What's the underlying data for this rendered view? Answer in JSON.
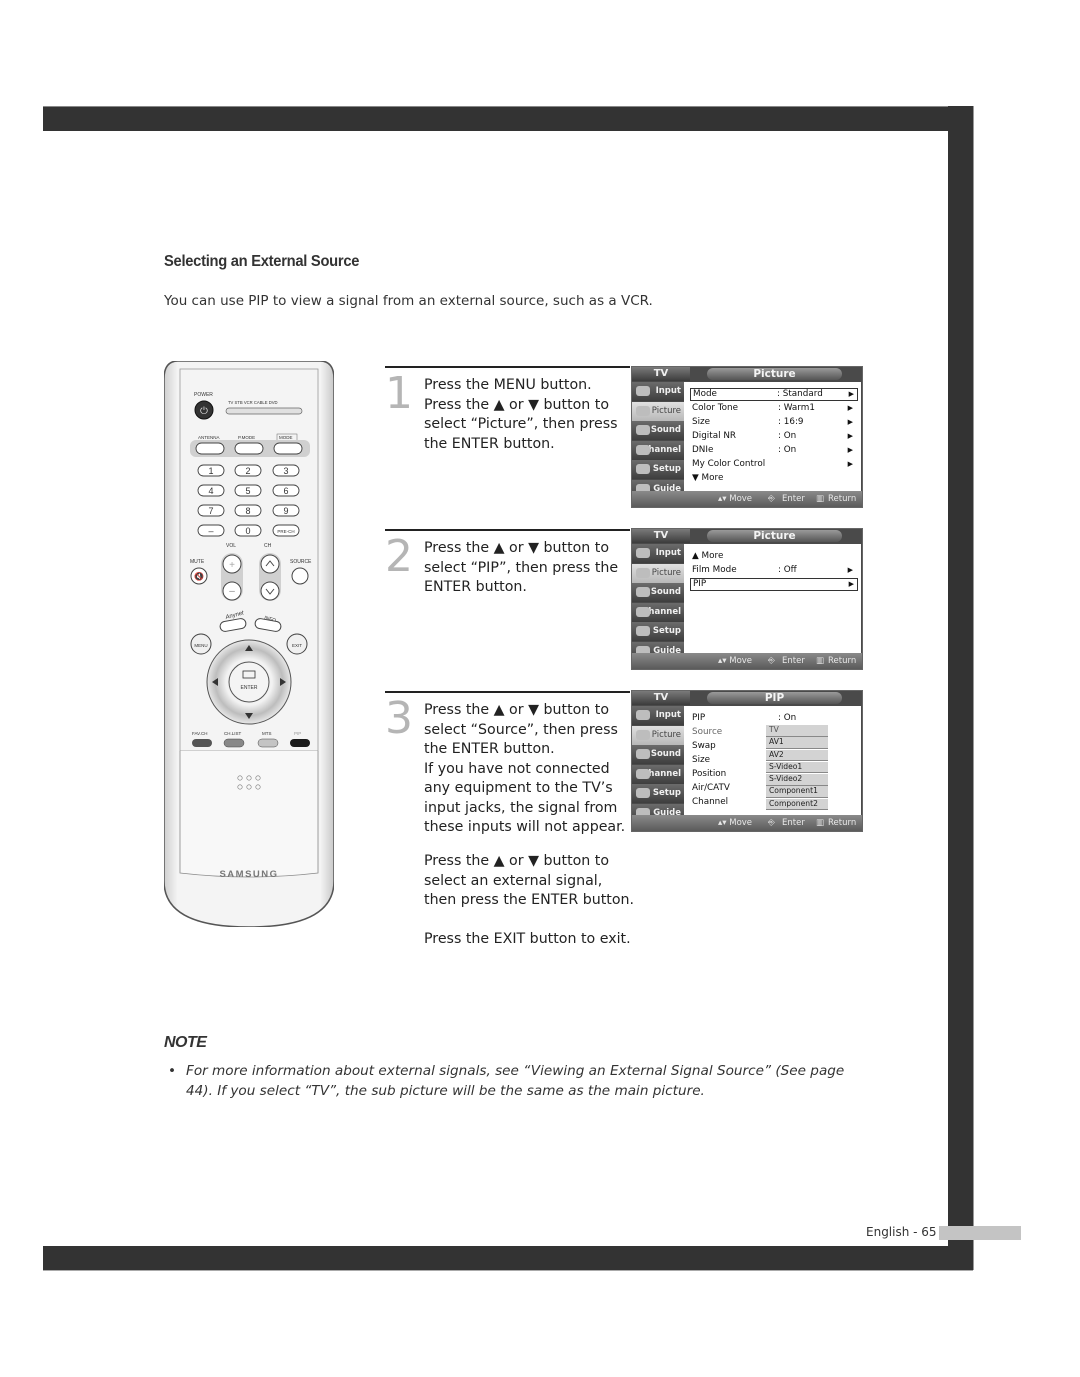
{
  "section": {
    "title": "Selecting an External Source",
    "intro": "You can use PIP to view a signal from an external source, such as a VCR."
  },
  "remote": {
    "brand": "SAMSUNG",
    "labels": {
      "power": "POWER",
      "modes": [
        "TV",
        "STB",
        "VCR",
        "CABLE",
        "DVD"
      ],
      "antenna": "ANTENNA",
      "pmode": "P.MODE",
      "mode": "MODE",
      "digits": [
        "1",
        "2",
        "3",
        "4",
        "5",
        "6",
        "7",
        "8",
        "9",
        "—",
        "0",
        "PRE-CH"
      ],
      "vol": "VOL",
      "ch": "CH",
      "mute": "MUTE",
      "source": "SOURCE",
      "info": "INFO",
      "menu": "MENU",
      "exit": "EXIT",
      "enter": "ENTER",
      "favch": "FAV.CH",
      "chlist": "CH.LIST",
      "mts": "MTS",
      "pip": "PIP"
    }
  },
  "steps": [
    {
      "number": "1",
      "lines": [
        "Press the MENU button.",
        "Press the ▲ or ▼ button to",
        "select “Picture”, then press",
        "the ENTER button."
      ]
    },
    {
      "number": "2",
      "lines": [
        "Press the ▲ or ▼ button to",
        "select “PIP”, then press the",
        "ENTER button."
      ]
    },
    {
      "number": "3",
      "lines": [
        "Press the ▲ or ▼ button to",
        "select “Source”, then press",
        "the ENTER button.",
        "If you have not connected",
        "any equipment to the TV’s",
        "input jacks, the signal from",
        "these inputs will not appear."
      ],
      "extra1": [
        "Press the ▲ or ▼ button to",
        "select an external signal,",
        "then press the ENTER button."
      ],
      "extra2": "Press the EXIT button to exit."
    }
  ],
  "osd_common": {
    "tv_label": "TV",
    "sidebar": [
      "Input",
      "Picture",
      "Sound",
      "Channel",
      "Setup",
      "Guide"
    ],
    "footer": {
      "move": "▴▾ Move",
      "enter": "Enter",
      "return": "Return"
    }
  },
  "osd": [
    {
      "title": "Picture",
      "rows": [
        {
          "label": "Mode",
          "value": ": Standard",
          "arrow": "▶",
          "selected": true
        },
        {
          "label": "Color Tone",
          "value": ": Warm1",
          "arrow": "▶"
        },
        {
          "label": "Size",
          "value": ": 16:9",
          "arrow": "▶"
        },
        {
          "label": "Digital NR",
          "value": ": On",
          "arrow": "▶"
        },
        {
          "label": "DNIe",
          "value": ": On",
          "arrow": "▶"
        },
        {
          "label": "My Color Control",
          "value": "",
          "arrow": "▶"
        },
        {
          "label": "▼ More",
          "value": "",
          "arrow": ""
        }
      ]
    },
    {
      "title": "Picture",
      "rows": [
        {
          "label": "▲ More",
          "value": "",
          "arrow": ""
        },
        {
          "label": "Film Mode",
          "value": ": Off",
          "arrow": "▶"
        },
        {
          "label": "PIP",
          "value": "",
          "arrow": "▶",
          "selected": true
        }
      ]
    },
    {
      "title": "PIP",
      "rows": [
        {
          "label": "PIP",
          "value": ": On"
        },
        {
          "label": "Source",
          "value": ""
        },
        {
          "label": "Swap",
          "value": ""
        },
        {
          "label": "Size",
          "value": ""
        },
        {
          "label": "Position",
          "value": ""
        },
        {
          "label": "Air/CATV",
          "value": ""
        },
        {
          "label": "Channel",
          "value": ""
        }
      ],
      "source_options": [
        "TV",
        "AV1",
        "AV2",
        "S-Video1",
        "S-Video2",
        "Component1",
        "Component2"
      ]
    }
  ],
  "note": {
    "title": "NOTE",
    "bullet": "•",
    "text": "For more information about external signals, see “Viewing an External Signal Source” (See page 44). If you select “TV”, the sub picture will be the same as the main picture."
  },
  "footer": {
    "page_label": "English - 65"
  }
}
